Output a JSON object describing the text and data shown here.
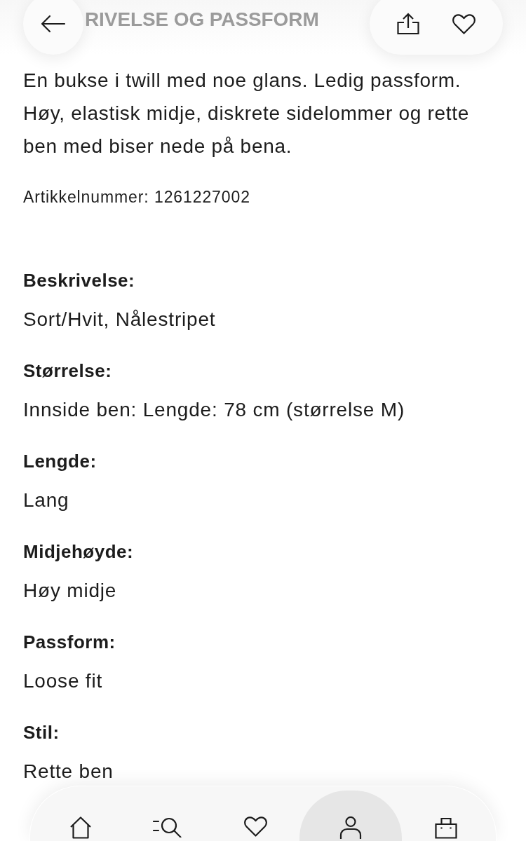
{
  "header": {
    "title": "RIVELSE OG PASSFORM"
  },
  "description": "En bukse i twill med noe glans. Ledig passform. Høy, elastisk midje, diskrete sidelommer og rette ben med biser nede på bena.",
  "article_number": "Artikkelnummer: 1261227002",
  "details": [
    {
      "label": "Beskrivelse:",
      "value": "Sort/Hvit, Nålestripet"
    },
    {
      "label": "Størrelse:",
      "value": "Innside ben: Lengde: 78 cm (størrelse M)"
    },
    {
      "label": "Lengde:",
      "value": "Lang"
    },
    {
      "label": "Midjehøyde:",
      "value": "Høy midje"
    },
    {
      "label": "Passform:",
      "value": "Loose fit"
    },
    {
      "label": "Stil:",
      "value": "Rette ben"
    }
  ],
  "bottom_nav": [
    {
      "kind": "home",
      "selected": false
    },
    {
      "kind": "search",
      "selected": false
    },
    {
      "kind": "favorites",
      "selected": false
    },
    {
      "kind": "account",
      "selected": true
    },
    {
      "kind": "bag",
      "selected": false
    }
  ]
}
